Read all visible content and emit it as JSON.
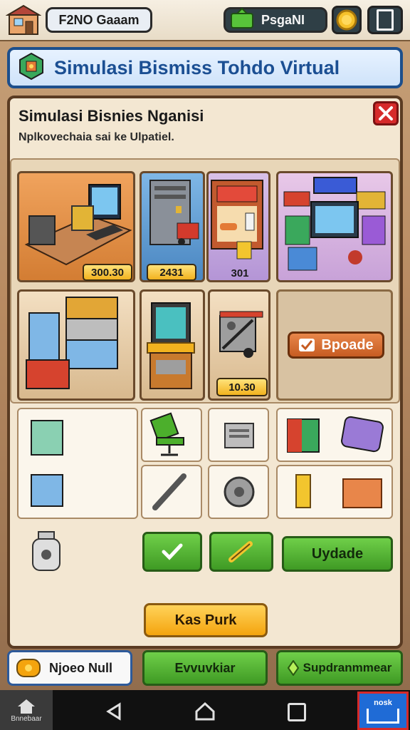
{
  "header": {
    "game_name": "F2NO Gaaam",
    "currency_label": "PsgaNI"
  },
  "banner": {
    "title": "Simulasi Bismiss Tohdo Virtual"
  },
  "panel": {
    "title": "Simulasi Bisnies Nganisi",
    "subtitle": "Nplkovechaia sai ke Ulpatiel."
  },
  "shop": {
    "items": [
      {
        "name": "computer-desk",
        "price": "300.30"
      },
      {
        "name": "server-cabinet",
        "price": "2431"
      },
      {
        "name": "storefront-kiosk",
        "price": "301"
      },
      {
        "name": "electronics-store",
        "price": ""
      },
      {
        "name": "inventory-stack",
        "price": ""
      },
      {
        "name": "vending-machine",
        "price": ""
      },
      {
        "name": "market-cart",
        "price": "10.30"
      }
    ],
    "upgrade_label": "Bpoade"
  },
  "actions": {
    "upgrade_label": "Uydade"
  },
  "main_button": "Kas Purk",
  "bottom_buttons": {
    "left": "Njoeo Null",
    "middle": "Evvuvkiar",
    "right": "Supdranmmear"
  },
  "nav": {
    "home_label": "Bnnebaar",
    "right_badge": "nosk"
  },
  "colors": {
    "banner_border": "#1d4f8c",
    "panel_border": "#5a3b22",
    "green": "#4caf2c",
    "orange": "#f4a40e",
    "close_red": "#d62a2a"
  }
}
